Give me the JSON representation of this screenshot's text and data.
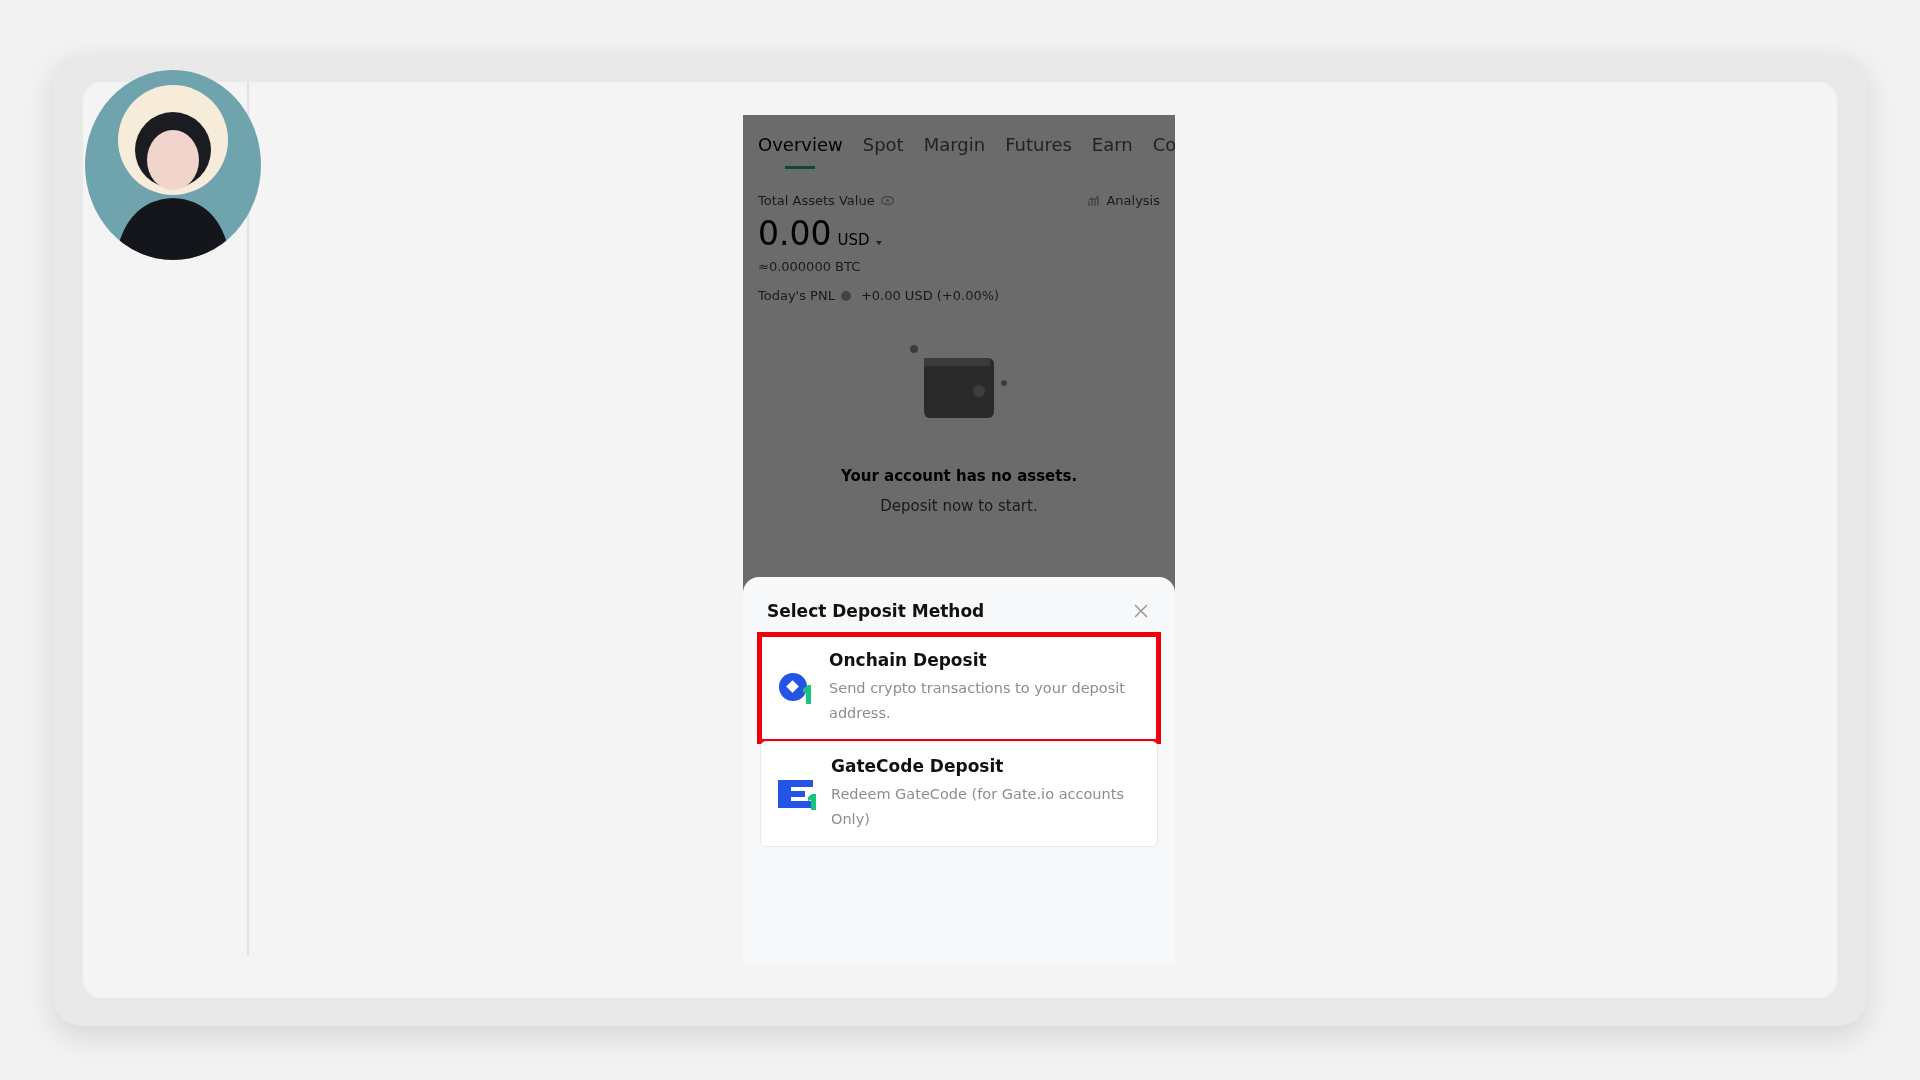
{
  "tabs": [
    {
      "label": "Overview",
      "selected": true
    },
    {
      "label": "Spot",
      "selected": false
    },
    {
      "label": "Margin",
      "selected": false
    },
    {
      "label": "Futures",
      "selected": false
    },
    {
      "label": "Earn",
      "selected": false
    },
    {
      "label": "Co",
      "selected": false
    }
  ],
  "assets": {
    "label": "Total Assets Value",
    "analysis": "Analysis",
    "amount": "0.00",
    "currency": "USD",
    "btc": "≈0.000000 BTC",
    "pnl_label": "Today's PNL",
    "pnl_value": "+0.00 USD (+0.00%)"
  },
  "empty_state": {
    "title": "Your account has no assets.",
    "subtitle": "Deposit now to start."
  },
  "sheet": {
    "title": "Select Deposit Method",
    "options": [
      {
        "kind": "onchain",
        "title": "Onchain Deposit",
        "description": "Send crypto transactions to your deposit address.",
        "highlighted": true
      },
      {
        "kind": "gatecode",
        "title": "GateCode Deposit",
        "description": "Redeem GateCode (for Gate.io accounts Only)",
        "highlighted": false
      }
    ]
  }
}
